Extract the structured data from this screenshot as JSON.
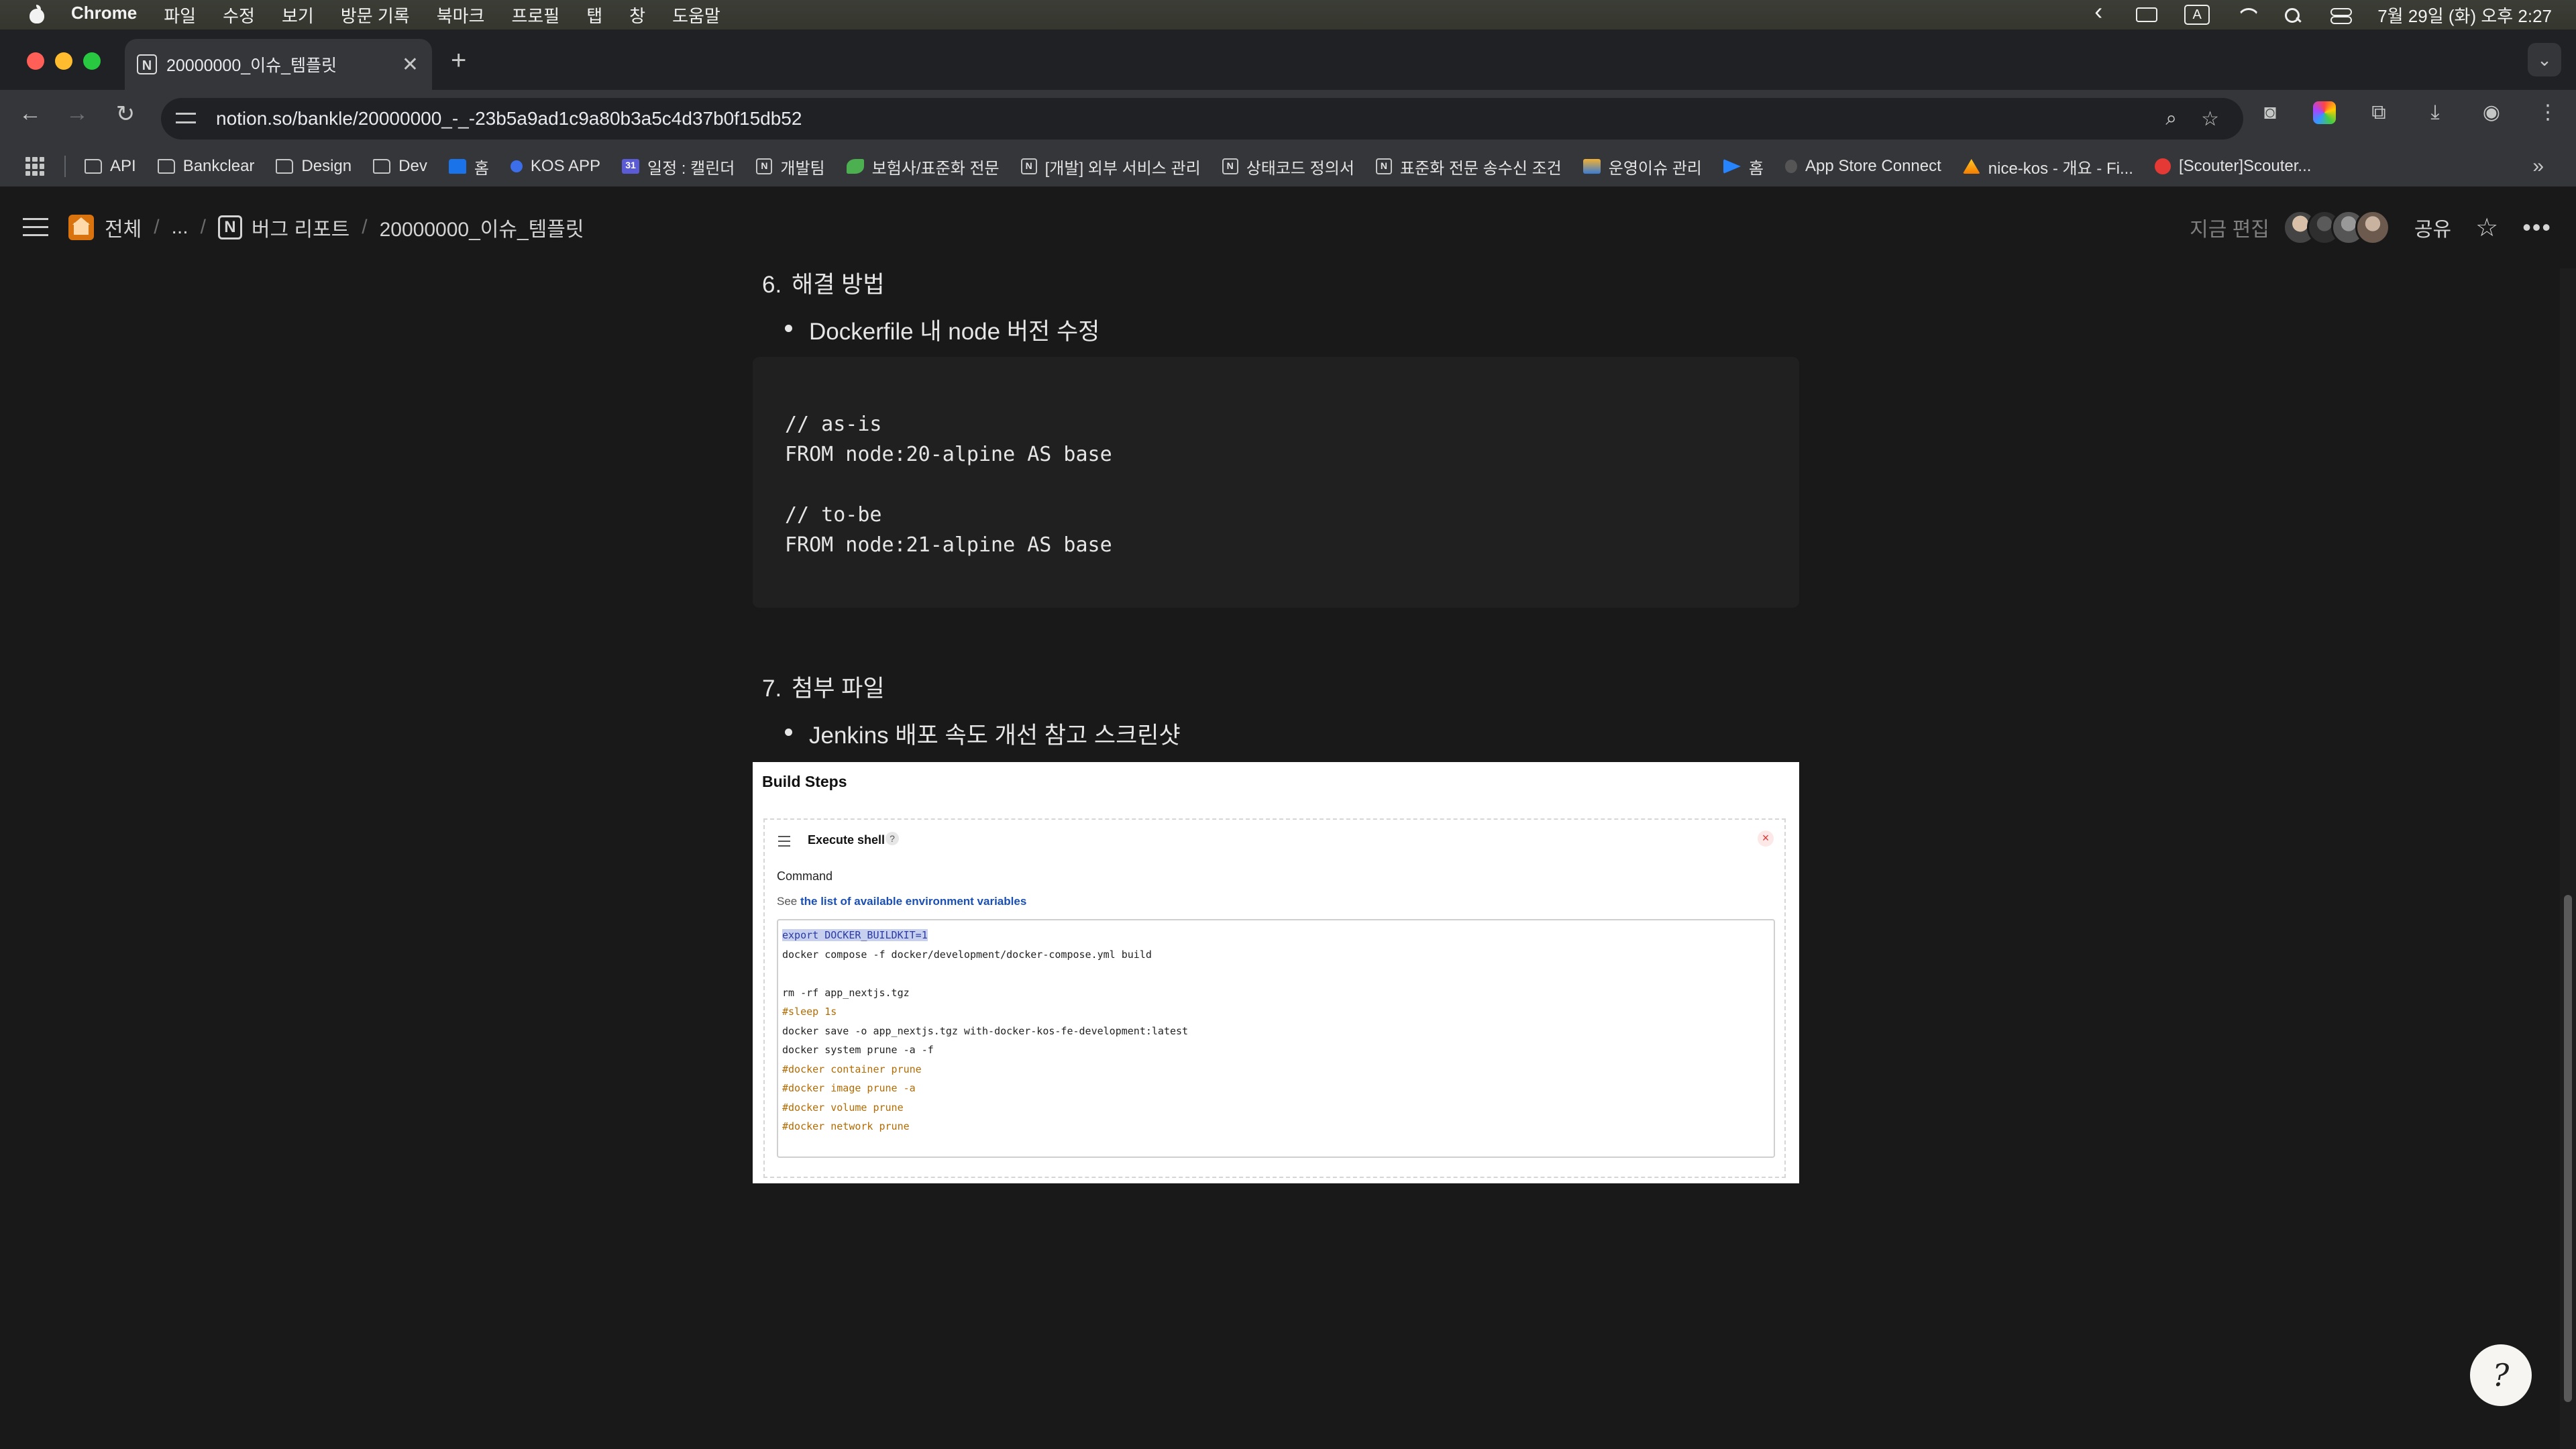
{
  "menubar": {
    "items": [
      "Chrome",
      "파일",
      "수정",
      "보기",
      "방문 기록",
      "북마크",
      "프로필",
      "탭",
      "창",
      "도움말"
    ],
    "input_indicator": "A",
    "datetime": "7월 29일 (화) 오후 2:27"
  },
  "tab": {
    "title": "20000000_이슈_템플릿",
    "favicon": "N"
  },
  "toolbar": {
    "url": "notion.so/bankle/20000000_-_-23b5a9ad1c9a80b3a5c4d37b0f15db52"
  },
  "bookmarks": [
    {
      "label": "API",
      "icon": "folder-icon"
    },
    {
      "label": "Bankclear",
      "icon": "folder-icon"
    },
    {
      "label": "Design",
      "icon": "folder-icon"
    },
    {
      "label": "Dev",
      "icon": "folder-icon"
    },
    {
      "label": "홈",
      "icon": "home-icon"
    },
    {
      "label": "KOS APP",
      "icon": "kos-icon"
    },
    {
      "label": "일정 : 캘린더",
      "icon": "calendar-icon"
    },
    {
      "label": "개발팀",
      "icon": "notion-icon"
    },
    {
      "label": "보험사/표준화 전문",
      "icon": "puzzle-icon"
    },
    {
      "label": "[개발] 외부 서비스 관리",
      "icon": "notion-icon"
    },
    {
      "label": "상태코드 정의서",
      "icon": "notion-icon"
    },
    {
      "label": "표준화 전문 송수신 조건",
      "icon": "notion-icon"
    },
    {
      "label": "운영이슈 관리",
      "icon": "image-icon"
    },
    {
      "label": "홈",
      "icon": "jira-icon"
    },
    {
      "label": "App Store Connect",
      "icon": "apple-icon"
    },
    {
      "label": "nice-kos - 개요 - Fi...",
      "icon": "firebase-icon"
    },
    {
      "label": "[Scouter]Scouter...",
      "icon": "scouter-icon"
    }
  ],
  "notion": {
    "breadcrumb": [
      "전체",
      "...",
      "버그 리포트",
      "20000000_이슈_템플릿"
    ],
    "edited": "지금 편집",
    "share": "공유"
  },
  "content": {
    "section6": {
      "num": "6.",
      "title": "해결 방법"
    },
    "bullet6": "Dockerfile 내 node 버전 수정",
    "code": "// as-is\nFROM node:20-alpine AS base\n\n// to-be\nFROM node:21-alpine AS base",
    "section7": {
      "num": "7.",
      "title": "첨부 파일"
    },
    "bullet7": "Jenkins 배포 속도 개선 참고 스크린샷",
    "jenkins": {
      "title": "Build Steps",
      "step": "Execute shell",
      "help": "?",
      "command_label": "Command",
      "see_prefix": "See ",
      "see_link": "the list of available environment variables",
      "lines": [
        "export DOCKER_BUILDKIT=1",
        "docker compose -f docker/development/docker-compose.yml build",
        "",
        "rm -rf app_nextjs.tgz",
        "#sleep 1s",
        "docker save -o app_nextjs.tgz with-docker-kos-fe-development:latest",
        "docker system prune -a -f",
        "#docker container prune",
        "#docker image prune -a",
        "#docker volume prune",
        "#docker network prune"
      ]
    }
  },
  "fab": {
    "label": "?"
  }
}
